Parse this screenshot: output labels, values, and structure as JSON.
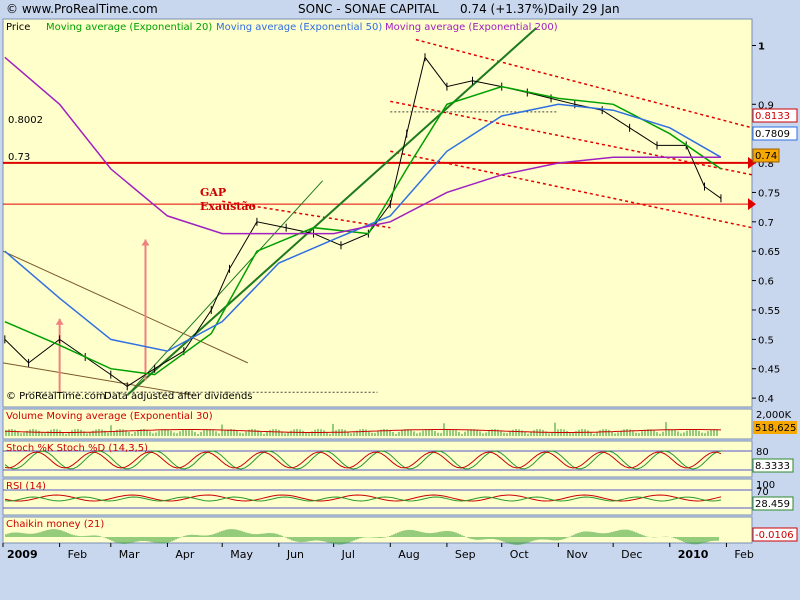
{
  "header": {
    "site": "© www.ProRealTime.com",
    "instrument": "SONC - SONAE CAPITAL",
    "quote": "0.74 (+1.37%)",
    "period": "Daily",
    "date": "29 Jan"
  },
  "price_panel": {
    "label": "Price",
    "ma20_label": "Moving average (Exponential 20)",
    "ma50_label": "Moving average (Exponential 50)",
    "ma200_label": "Moving average (Exponential 200)",
    "level_1": "0.8002",
    "level_2": "0.73",
    "annotation_gap": "GAP",
    "annotation_exaustao": "Exaustão",
    "footer_copyright": "© ProRealTime.com",
    "footer_note": "Data adjusted after dividends",
    "right_tag_1": "0.8133",
    "right_tag_2": "0.7809",
    "right_tag_3": "0.74"
  },
  "volume_panel": {
    "label": "Volume Moving average (Exponential 30)",
    "axis_top": "2,000K",
    "value": "518,625"
  },
  "stoch_panel": {
    "label": "Stoch %K Stoch %D (14,3,5)",
    "axis_top": "80",
    "value": "8.3333"
  },
  "rsi_panel": {
    "label": "RSI (14)",
    "axis_top": "100",
    "axis_mid": "70",
    "value": "28.459"
  },
  "chaikin_panel": {
    "label": "Chaikin money (21)",
    "value": "-0.0106"
  },
  "chart_data": {
    "type": "line",
    "title": "SONC - SONAE CAPITAL",
    "ylim": [
      0.39,
      1.04
    ],
    "y_ticks": [
      "1",
      "0.9",
      "0.8",
      "0.75",
      "0.7",
      "0.65",
      "0.6",
      "0.55",
      "0.5",
      "0.45",
      "0.4"
    ],
    "x_labels": [
      "2009",
      "Feb",
      "Mar",
      "Apr",
      "May",
      "Jun",
      "Jul",
      "Aug",
      "Sep",
      "Oct",
      "Nov",
      "Dec",
      "2010",
      "Feb"
    ],
    "series": [
      {
        "name": "Price",
        "color": "#000000",
        "x": [
          "2009-01-02",
          "2009-01-15",
          "2009-02-01",
          "2009-02-15",
          "2009-03-01",
          "2009-03-10",
          "2009-03-25",
          "2009-04-10",
          "2009-04-25",
          "2009-05-05",
          "2009-05-20",
          "2009-06-05",
          "2009-06-20",
          "2009-07-05",
          "2009-07-20",
          "2009-08-01",
          "2009-08-10",
          "2009-08-20",
          "2009-09-01",
          "2009-09-15",
          "2009-10-01",
          "2009-10-15",
          "2009-10-28",
          "2009-11-10",
          "2009-11-25",
          "2009-12-10",
          "2009-12-25",
          "2010-01-10",
          "2010-01-20",
          "2010-01-29"
        ],
        "values": [
          0.5,
          0.46,
          0.5,
          0.47,
          0.44,
          0.42,
          0.45,
          0.48,
          0.55,
          0.62,
          0.7,
          0.69,
          0.68,
          0.66,
          0.68,
          0.73,
          0.85,
          0.98,
          0.93,
          0.94,
          0.93,
          0.92,
          0.91,
          0.9,
          0.89,
          0.86,
          0.83,
          0.83,
          0.76,
          0.74
        ]
      },
      {
        "name": "Moving average (Exponential 20)",
        "color": "#00a000",
        "x": [
          "2009-01-02",
          "2009-02-01",
          "2009-03-01",
          "2009-03-25",
          "2009-04-25",
          "2009-05-20",
          "2009-06-20",
          "2009-07-20",
          "2009-08-10",
          "2009-09-01",
          "2009-10-01",
          "2009-11-01",
          "2009-12-01",
          "2010-01-01",
          "2010-01-29"
        ],
        "values": [
          0.53,
          0.49,
          0.45,
          0.44,
          0.51,
          0.65,
          0.69,
          0.68,
          0.79,
          0.9,
          0.93,
          0.91,
          0.9,
          0.85,
          0.79
        ]
      },
      {
        "name": "Moving average (Exponential 50)",
        "color": "#2f6fe0",
        "x": [
          "2009-01-02",
          "2009-02-01",
          "2009-03-01",
          "2009-04-01",
          "2009-05-01",
          "2009-06-01",
          "2009-07-01",
          "2009-08-01",
          "2009-09-01",
          "2009-10-01",
          "2009-11-01",
          "2009-12-01",
          "2010-01-01",
          "2010-01-29"
        ],
        "values": [
          0.65,
          0.57,
          0.5,
          0.48,
          0.53,
          0.63,
          0.67,
          0.71,
          0.82,
          0.88,
          0.9,
          0.89,
          0.86,
          0.81
        ]
      },
      {
        "name": "Moving average (Exponential 200)",
        "color": "#a020c0",
        "x": [
          "2009-01-02",
          "2009-02-01",
          "2009-03-01",
          "2009-04-01",
          "2009-05-01",
          "2009-06-01",
          "2009-07-01",
          "2009-08-01",
          "2009-09-01",
          "2009-10-01",
          "2009-11-01",
          "2009-12-01",
          "2010-01-01",
          "2010-01-29"
        ],
        "values": [
          0.98,
          0.9,
          0.79,
          0.71,
          0.68,
          0.68,
          0.68,
          0.7,
          0.75,
          0.78,
          0.8,
          0.81,
          0.81,
          0.81
        ]
      }
    ],
    "horizontal_levels": [
      0.8002,
      0.73
    ],
    "xlabel": "",
    "ylabel": "Price",
    "grid": false
  }
}
